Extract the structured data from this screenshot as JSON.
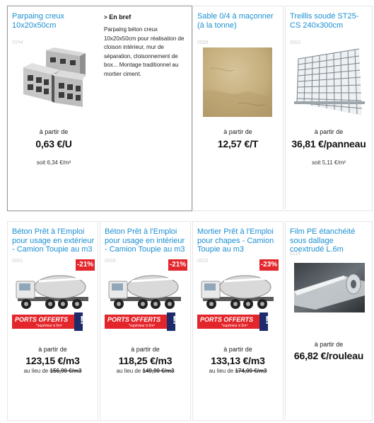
{
  "brief": {
    "title": "En bref",
    "text": "Parpaing béton creux 10x20x50cm pour réalisation de cloison intérieur, mur de séparation, cloisonnement de box... Montage traditionnel au mortier ciment."
  },
  "products": [
    {
      "title": "Parpaing creux 10x20x50cm",
      "ref": "0194",
      "price_from": "à partir de",
      "price": "0,63 €/U",
      "sub": "soit 6,34 €/m²",
      "image": "concrete-blocks"
    },
    {
      "title": "Sable 0/4 à maçonner (à la tonne)",
      "ref": "0009",
      "price_from": "à partir de",
      "price": "12,57 €/T",
      "image": "sand"
    },
    {
      "title": "Treillis soudé ST25-CS 240x300cm",
      "ref": "0002",
      "price_from": "à partir de",
      "price": "36,81 €/panneau",
      "sub": "soit 5,11 €/m²",
      "image": "wire-mesh"
    },
    {
      "title": "Béton Prêt à l'Emploi pour usage en extérieur - Camion Toupie au m3",
      "ref": "0001",
      "badge": "-21%",
      "promo": "PORTS OFFERTS",
      "promo_sub": "*supérieur à 5m³",
      "price_from": "à partir de",
      "price": "123,15 €/m3",
      "sub_prefix": "au lieu de",
      "old_price": "156,90 €/m3",
      "image": "concrete-mixer-truck"
    },
    {
      "title": "Béton Prêt à l'Emploi pour usage en intérieur - Camion Toupie au m3",
      "ref": "0003",
      "badge": "-21%",
      "promo": "PORTS OFFERTS",
      "promo_sub": "*supérieur à 5m³",
      "price_from": "à partir de",
      "price": "118,25 €/m3",
      "sub_prefix": "au lieu de",
      "old_price": "149,90 €/m3",
      "image": "concrete-mixer-truck"
    },
    {
      "title": "Mortier Prêt à l'Emploi pour chapes - Camion Toupie au m3",
      "ref": "0020",
      "badge": "-23%",
      "promo": "PORTS OFFERTS",
      "promo_sub": "*supérieur à 5m³",
      "price_from": "à partir de",
      "price": "133,13 €/m3",
      "sub_prefix": "au lieu de",
      "old_price": "174,00 €/m3",
      "image": "concrete-mixer-truck"
    },
    {
      "title": "Film PE étanchéité sous dallage coextrudé L.6m",
      "ref": "0114",
      "price_from": "à partir de",
      "price": "66,82 €/rouleau",
      "image": "plastic-film-roll"
    }
  ],
  "colors": {
    "title": "#1b8fd1",
    "badge": "#e3262b",
    "price": "#111111"
  }
}
